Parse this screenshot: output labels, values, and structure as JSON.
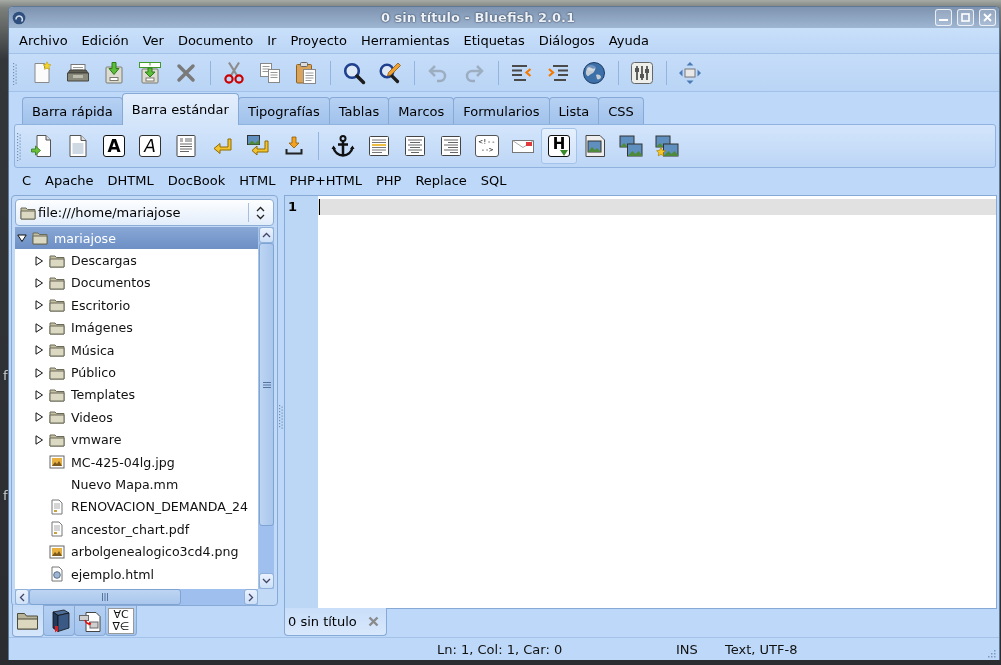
{
  "desktop": {
    "icon_labels": [
      "f",
      "f"
    ]
  },
  "window": {
    "title": "0 sin título - Bluefish 2.0.1"
  },
  "menu_bar": [
    "Archivo",
    "Edición",
    "Ver",
    "Documento",
    "Ir",
    "Proyecto",
    "Herramientas",
    "Etiquetas",
    "Diálogos",
    "Ayuda"
  ],
  "main_toolbar": {
    "groups": [
      [
        {
          "disabled": false
        },
        {
          "disabled": false
        },
        {
          "disabled": false
        },
        {
          "disabled": false
        },
        {
          "disabled": false
        }
      ],
      [
        {
          "disabled": false
        },
        {
          "disabled": false
        },
        {
          "disabled": false
        }
      ],
      [
        {
          "disabled": false
        },
        {
          "disabled": false
        }
      ],
      [
        {
          "disabled": true
        },
        {
          "disabled": true
        }
      ],
      [
        {
          "disabled": false
        },
        {
          "disabled": false
        },
        {
          "disabled": false
        }
      ],
      [
        {
          "disabled": false
        }
      ],
      [
        {
          "disabled": false
        }
      ]
    ]
  },
  "toolbar_tabs": [
    {
      "label": "Barra rápida",
      "selected": false
    },
    {
      "label": "Barra estándar",
      "selected": true
    },
    {
      "label": "Tipografías",
      "selected": false
    },
    {
      "label": "Tablas",
      "selected": false
    },
    {
      "label": "Marcos",
      "selected": false
    },
    {
      "label": "Formularios",
      "selected": false
    },
    {
      "label": "Lista",
      "selected": false
    },
    {
      "label": "CSS",
      "selected": false
    }
  ],
  "html_toolbar": {
    "groups": [
      [
        {
          "hovered": false
        },
        {
          "hovered": false
        },
        {
          "hovered": false,
          "glyph": "A"
        },
        {
          "hovered": false,
          "glyph": "A"
        },
        {
          "hovered": false
        },
        {
          "hovered": false
        },
        {
          "hovered": false
        },
        {
          "hovered": false
        }
      ],
      [
        {
          "hovered": false
        },
        {
          "hovered": false
        },
        {
          "hovered": false
        },
        {
          "hovered": false
        },
        {
          "hovered": false,
          "glyph": "<!-- -->"
        },
        {
          "hovered": false
        },
        {
          "hovered": true,
          "glyph": "H"
        },
        {
          "hovered": false
        },
        {
          "hovered": false
        },
        {
          "hovered": false
        }
      ]
    ]
  },
  "custom_menu": [
    "C",
    "Apache",
    "DHTML",
    "DocBook",
    "HTML",
    "PHP+HTML",
    "PHP",
    "Replace",
    "SQL"
  ],
  "file_panel": {
    "location": "file:///home/mariajose",
    "tree": [
      {
        "label": "mariajose",
        "kind": "folder",
        "expanded": true,
        "selected": true,
        "children": [
          {
            "label": "Descargas",
            "kind": "folder",
            "expanded": false,
            "selected": false
          },
          {
            "label": "Documentos",
            "kind": "folder",
            "expanded": false,
            "selected": false
          },
          {
            "label": "Escritorio",
            "kind": "folder",
            "expanded": false,
            "selected": false
          },
          {
            "label": "Imágenes",
            "kind": "folder",
            "expanded": false,
            "selected": false
          },
          {
            "label": "Música",
            "kind": "folder",
            "expanded": false,
            "selected": false
          },
          {
            "label": "Público",
            "kind": "folder",
            "expanded": false,
            "selected": false
          },
          {
            "label": "Templates",
            "kind": "folder",
            "expanded": false,
            "selected": false
          },
          {
            "label": "Videos",
            "kind": "folder",
            "expanded": false,
            "selected": false
          },
          {
            "label": "vmware",
            "kind": "folder",
            "expanded": false,
            "selected": false
          },
          {
            "label": "MC-425-04lg.jpg",
            "kind": "image",
            "selected": false
          },
          {
            "label": "Nuevo Mapa.mm",
            "kind": "plain",
            "selected": false
          },
          {
            "label": "RENOVACION_DEMANDA_24",
            "kind": "document",
            "selected": false
          },
          {
            "label": "ancestor_chart.pdf",
            "kind": "document",
            "selected": false
          },
          {
            "label": "arbolgenealogico3cd4.png",
            "kind": "image",
            "selected": false
          },
          {
            "label": "ejemplo.html",
            "kind": "html",
            "selected": false
          }
        ]
      }
    ],
    "tabs": [
      {
        "selected": true
      },
      {
        "selected": false
      },
      {
        "selected": false
      },
      {
        "selected": false,
        "glyph": "∀C ∇∈"
      }
    ]
  },
  "editor": {
    "line_numbers": [
      "1"
    ]
  },
  "document_tabs": [
    {
      "label": "0 sin título",
      "selected": true
    }
  ],
  "status_bar": {
    "position": "Ln: 1, Col: 1, Car: 0",
    "mode": "INS",
    "encoding": "Text, UTF-8"
  }
}
